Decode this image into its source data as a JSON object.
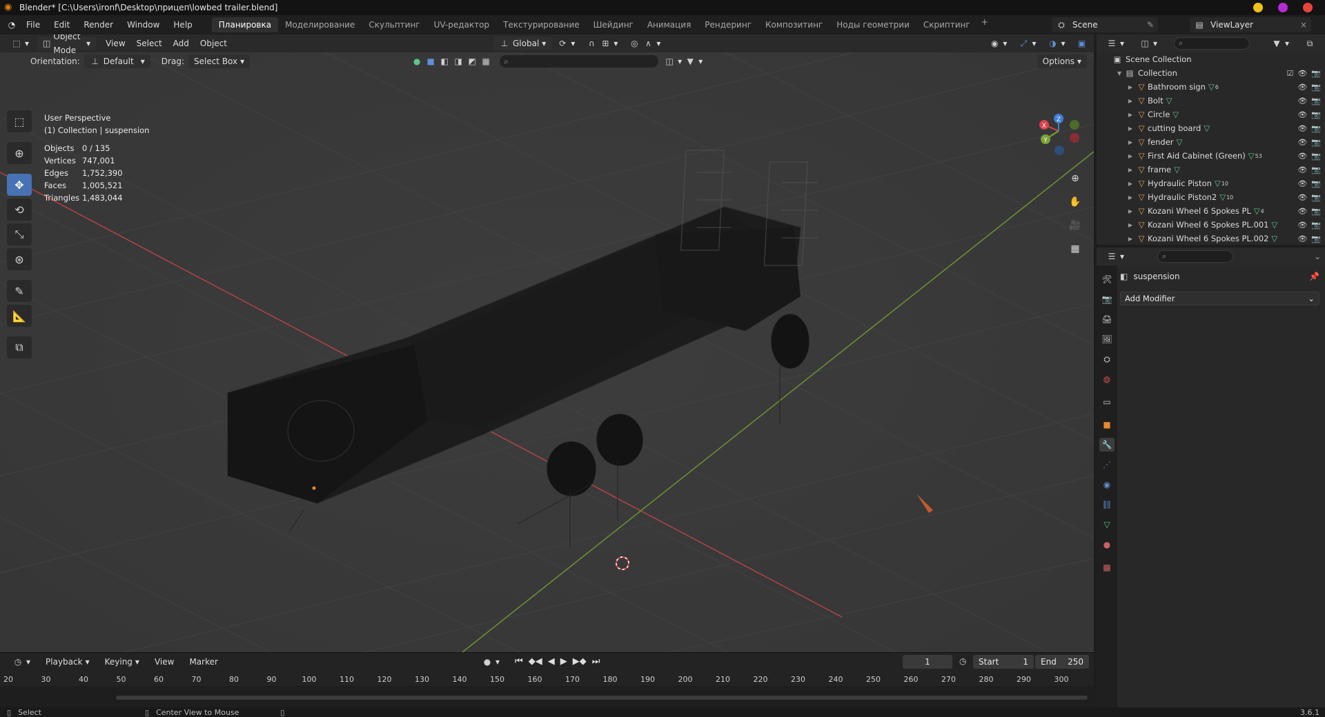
{
  "window": {
    "title": "Blender* [C:\\Users\\ironf\\Desktop\\прицеп\\lowbed trailer.blend]"
  },
  "menu": [
    "File",
    "Edit",
    "Render",
    "Window",
    "Help"
  ],
  "workspaces": [
    "Планировка",
    "Моделирование",
    "Скульптинг",
    "UV-редактор",
    "Текстурирование",
    "Шейдинг",
    "Анимация",
    "Рендеринг",
    "Композитинг",
    "Ноды геометрии",
    "Скриптинг"
  ],
  "scene": {
    "name": "Scene",
    "view_layer": "ViewLayer"
  },
  "viewport": {
    "mode": "Object Mode",
    "menus": [
      "View",
      "Select",
      "Add",
      "Object"
    ],
    "transform_orientation": "Global",
    "orientation_label": "Orientation:",
    "orientation_value": "Default",
    "drag_label": "Drag:",
    "drag_value": "Select Box",
    "options_label": "Options",
    "perspective": "User Perspective",
    "active": "(1) Collection | suspension",
    "stats": [
      {
        "key": "Objects",
        "value": "0 / 135"
      },
      {
        "key": "Vertices",
        "value": "747,001"
      },
      {
        "key": "Edges",
        "value": "1,752,390"
      },
      {
        "key": "Faces",
        "value": "1,005,521"
      },
      {
        "key": "Triangles",
        "value": "1,483,044"
      }
    ],
    "gizmo": {
      "x": "X",
      "y": "Y",
      "z": "Z"
    }
  },
  "outliner": {
    "root": "Scene Collection",
    "collection": "Collection",
    "items": [
      {
        "name": "Bathroom sign",
        "badge": "6"
      },
      {
        "name": "Bolt",
        "badge": ""
      },
      {
        "name": "Circle",
        "badge": ""
      },
      {
        "name": "cutting board",
        "badge": ""
      },
      {
        "name": "fender",
        "badge": ""
      },
      {
        "name": "First Aid Cabinet (Green)",
        "badge": "53"
      },
      {
        "name": "frame",
        "badge": ""
      },
      {
        "name": "Hydraulic Piston",
        "badge": "10"
      },
      {
        "name": "Hydraulic Piston2",
        "badge": "10"
      },
      {
        "name": "Kozani Wheel 6 Spokes PL",
        "badge": "4"
      },
      {
        "name": "Kozani Wheel 6 Spokes PL.001",
        "badge": ""
      },
      {
        "name": "Kozani Wheel 6 Spokes PL.002",
        "badge": ""
      }
    ]
  },
  "properties": {
    "object_name": "suspension",
    "add_modifier": "Add Modifier"
  },
  "timeline": {
    "menus": [
      "Playback",
      "Keying",
      "View",
      "Marker"
    ],
    "current_frame": "1",
    "start_label": "Start",
    "start": "1",
    "end_label": "End",
    "end": "250",
    "ruler": [
      "20",
      "30",
      "40",
      "50",
      "60",
      "70",
      "80",
      "90",
      "100",
      "110",
      "120",
      "130",
      "140",
      "150",
      "160",
      "170",
      "180",
      "190",
      "200",
      "210",
      "220",
      "230",
      "240",
      "250",
      "260",
      "270",
      "280",
      "290",
      "300"
    ]
  },
  "statusbar": {
    "left": "Select",
    "middle": "Center View to Mouse",
    "version": "3.6.1"
  },
  "colors": {
    "accent": "#4772b3",
    "x_axis": "#d8424a",
    "y_axis": "#7aa33a",
    "z_axis": "#3f7fd4",
    "object_orange": "#e8a05a"
  }
}
